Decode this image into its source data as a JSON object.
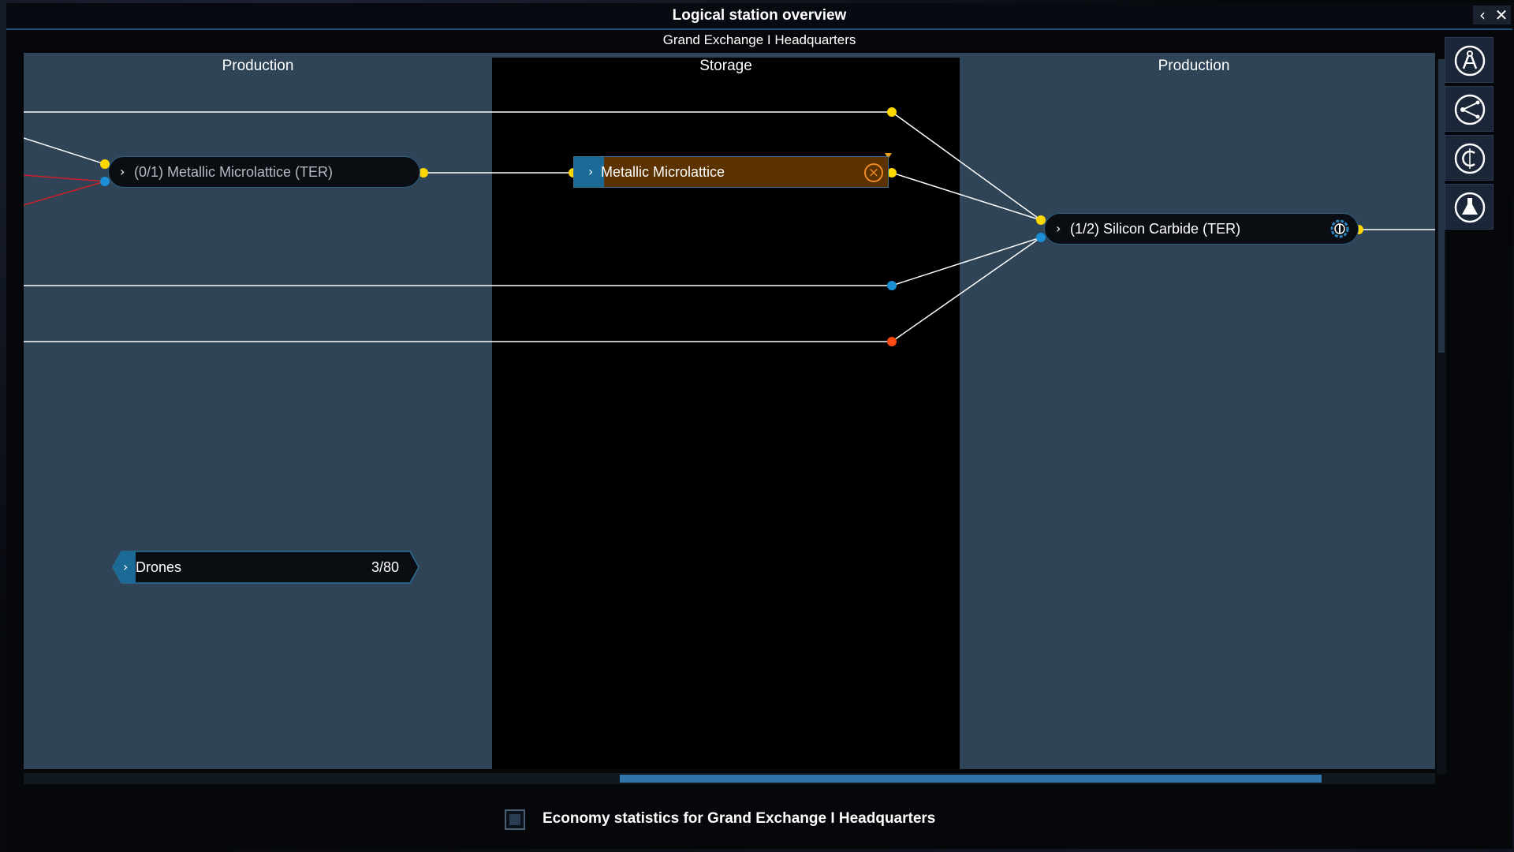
{
  "window": {
    "title": "Logical station overview",
    "subtitle": "Grand Exchange I Headquarters",
    "back_icon": "chevron-left-icon",
    "close_icon": "close-icon"
  },
  "columns": [
    {
      "label": "Production"
    },
    {
      "label": "Storage"
    },
    {
      "label": "Production"
    }
  ],
  "nodes": {
    "metallic_module": {
      "label": "(0/1) Metallic Microlattice (TER)",
      "status": "inactive"
    },
    "metallic_storage": {
      "label": "Metallic Microlattice",
      "status_icon": "cancel-icon"
    },
    "silicon_module": {
      "label": "(1/2) Silicon Carbide (TER)",
      "status_icon": "gear-icon"
    },
    "drones": {
      "label": "Drones",
      "value": "3/80"
    }
  },
  "toolbar": {
    "items": [
      {
        "icon": "compass-icon"
      },
      {
        "icon": "share-icon"
      },
      {
        "icon": "credits-icon"
      },
      {
        "icon": "flask-icon"
      }
    ]
  },
  "footer": {
    "checkbox_label": "Economy statistics for Grand Exchange I Headquarters",
    "checked": false
  },
  "colors": {
    "ware_link": "#ffd800",
    "energy_link": "#1a8fd6",
    "ore_link": "#ff4a12",
    "deficit_link": "#d01f2a",
    "production_bg": "#2f4457",
    "storage_bg": "#000000",
    "storage_node": "#5b3200"
  }
}
